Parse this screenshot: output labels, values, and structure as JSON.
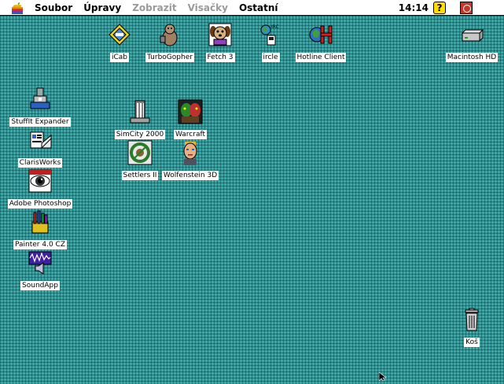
{
  "menubar": {
    "items": [
      "Soubor",
      "Úpravy",
      "Zobrazit",
      "Visačky",
      "Ostatní"
    ],
    "disabled": [
      false,
      false,
      true,
      true,
      false
    ],
    "clock": "14:14",
    "help_icon": "?"
  },
  "icons": {
    "icab": "iCab",
    "turbogopher": "TurboGopher",
    "fetch": "Fetch 3",
    "ircle": "ircle",
    "hotline": "Hotline Client",
    "macintosh_hd": "Macintosh HD",
    "stuffit": "StuffIt Expander",
    "simcity": "SimCity 2000",
    "warcraft": "Warcraft",
    "clarisworks": "ClarisWorks",
    "settlers": "Settlers II",
    "wolfenstein": "Wolfenstein 3D",
    "photoshop": "Adobe Photoshop",
    "painter": "Painter 4.0 CZ",
    "soundapp": "SoundApp",
    "trash": "Koš"
  },
  "colors": {
    "desktop": "#2a9999",
    "menubar": "#ffffff"
  }
}
